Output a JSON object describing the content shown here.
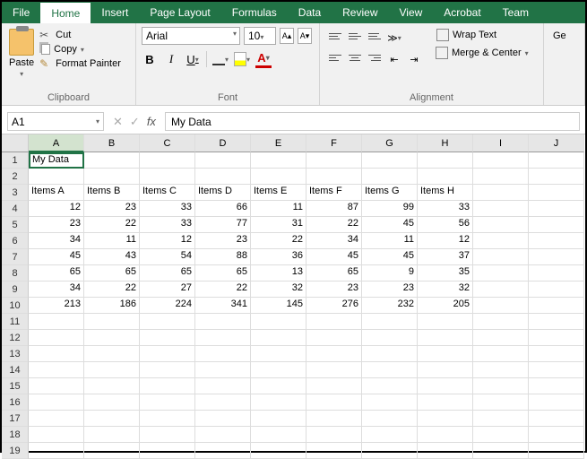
{
  "tabs": [
    "File",
    "Home",
    "Insert",
    "Page Layout",
    "Formulas",
    "Data",
    "Review",
    "View",
    "Acrobat",
    "Team"
  ],
  "activeTab": "Home",
  "clipboard": {
    "paste": "Paste",
    "cut": "Cut",
    "copy": "Copy",
    "format_painter": "Format Painter",
    "group": "Clipboard"
  },
  "font": {
    "name": "Arial",
    "size": "10",
    "group": "Font",
    "bold": "B",
    "italic": "I",
    "underline": "U",
    "color": "A"
  },
  "alignment": {
    "wrap": "Wrap Text",
    "merge": "Merge & Center",
    "group": "Alignment"
  },
  "general": {
    "label": "Ge"
  },
  "namebox": "A1",
  "formula_fx": "fx",
  "formula_value": "My Data",
  "columns": [
    "A",
    "B",
    "C",
    "D",
    "E",
    "F",
    "G",
    "H",
    "I",
    "J"
  ],
  "rows": [
    "1",
    "2",
    "3",
    "4",
    "5",
    "6",
    "7",
    "8",
    "9",
    "10",
    "11",
    "12",
    "13",
    "14",
    "15",
    "16",
    "17",
    "18",
    "19"
  ],
  "sheet": {
    "r1": {
      "A": "My Data"
    },
    "r3": {
      "A": "Items A",
      "B": "Items B",
      "C": "Items C",
      "D": "Items D",
      "E": "Items E",
      "F": "Items F",
      "G": "Items G",
      "H": "Items H"
    },
    "r4": {
      "A": "12",
      "B": "23",
      "C": "33",
      "D": "66",
      "E": "11",
      "F": "87",
      "G": "99",
      "H": "33"
    },
    "r5": {
      "A": "23",
      "B": "22",
      "C": "33",
      "D": "77",
      "E": "31",
      "F": "22",
      "G": "45",
      "H": "56"
    },
    "r6": {
      "A": "34",
      "B": "11",
      "C": "12",
      "D": "23",
      "E": "22",
      "F": "34",
      "G": "11",
      "H": "12"
    },
    "r7": {
      "A": "45",
      "B": "43",
      "C": "54",
      "D": "88",
      "E": "36",
      "F": "45",
      "G": "45",
      "H": "37"
    },
    "r8": {
      "A": "65",
      "B": "65",
      "C": "65",
      "D": "65",
      "E": "13",
      "F": "65",
      "G": "9",
      "H": "35"
    },
    "r9": {
      "A": "34",
      "B": "22",
      "C": "27",
      "D": "22",
      "E": "32",
      "F": "23",
      "G": "23",
      "H": "32"
    },
    "r10": {
      "A": "213",
      "B": "186",
      "C": "224",
      "D": "341",
      "E": "145",
      "F": "276",
      "G": "232",
      "H": "205"
    }
  }
}
